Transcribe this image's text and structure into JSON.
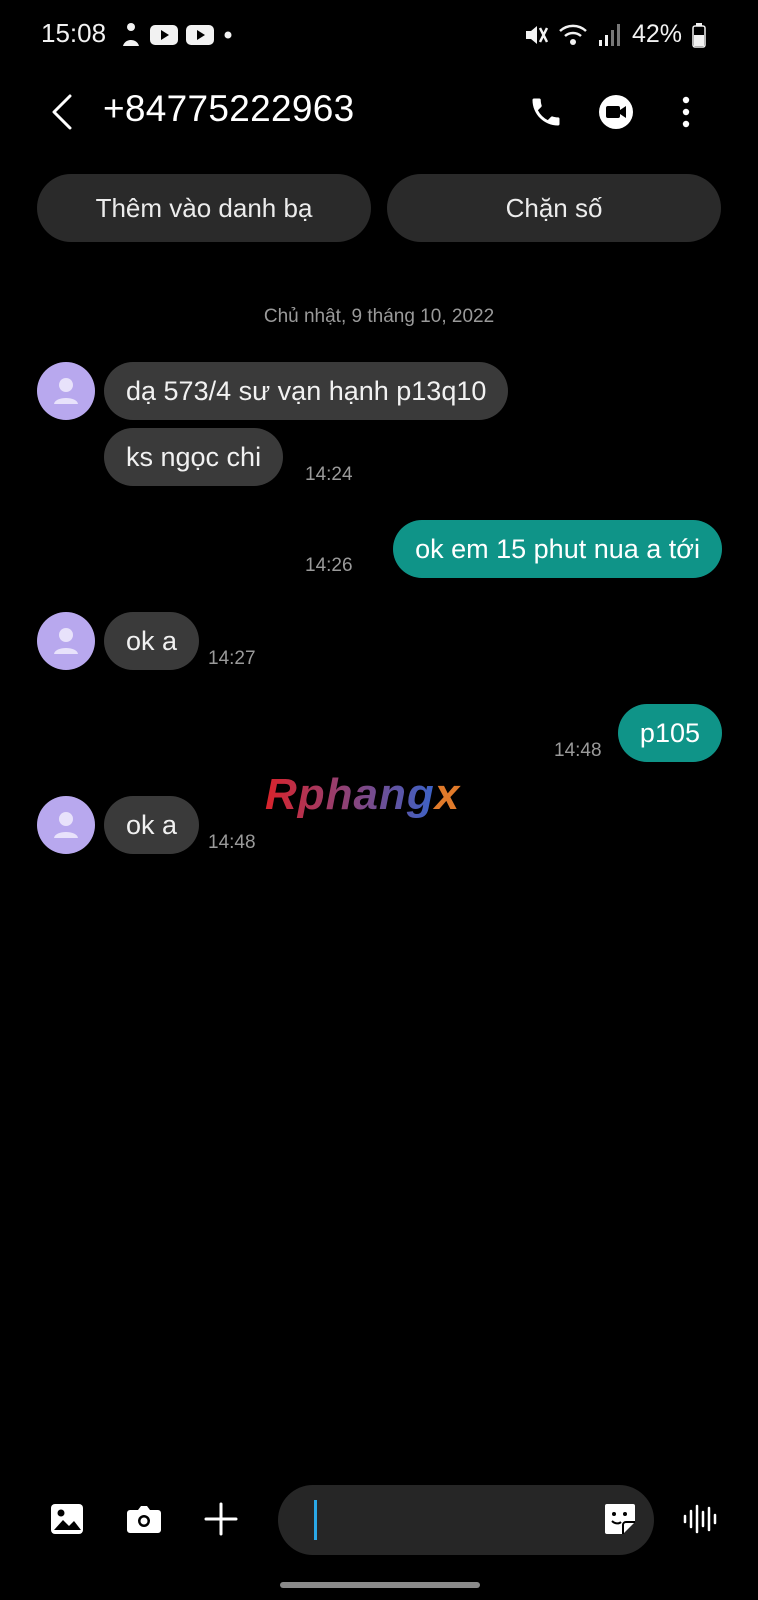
{
  "status_bar": {
    "time": "15:08",
    "battery": "42%"
  },
  "header": {
    "contact_number": "+84775222963"
  },
  "actions": {
    "add_contact": "Thêm vào danh bạ",
    "block_number": "Chặn số"
  },
  "conversation": {
    "date": "Chủ nhật, 9 tháng 10, 2022",
    "messages": [
      {
        "direction": "incoming",
        "text": "dạ 573/4 sư vạn hạnh p13q10",
        "time": ""
      },
      {
        "direction": "incoming",
        "text": "ks ngọc chi",
        "time": "14:24"
      },
      {
        "direction": "outgoing",
        "text": "ok em 15 phut nua a tới",
        "time": "14:26"
      },
      {
        "direction": "incoming",
        "text": "ok a",
        "time": "14:27"
      },
      {
        "direction": "outgoing",
        "text": "p105",
        "time": "14:48"
      },
      {
        "direction": "incoming",
        "text": "ok a",
        "time": "14:48"
      }
    ]
  },
  "watermark": {
    "text_part1": "Rphang",
    "text_part2": "x"
  },
  "colors": {
    "outgoing_bubble": "#0f9488",
    "incoming_bubble": "#3a3a3a",
    "avatar": "#b8a8ee"
  },
  "icons": [
    "back-arrow-icon",
    "phone-icon",
    "video-call-icon",
    "more-options-icon",
    "gallery-icon",
    "camera-icon",
    "plus-icon",
    "sticker-icon",
    "voice-icon"
  ]
}
